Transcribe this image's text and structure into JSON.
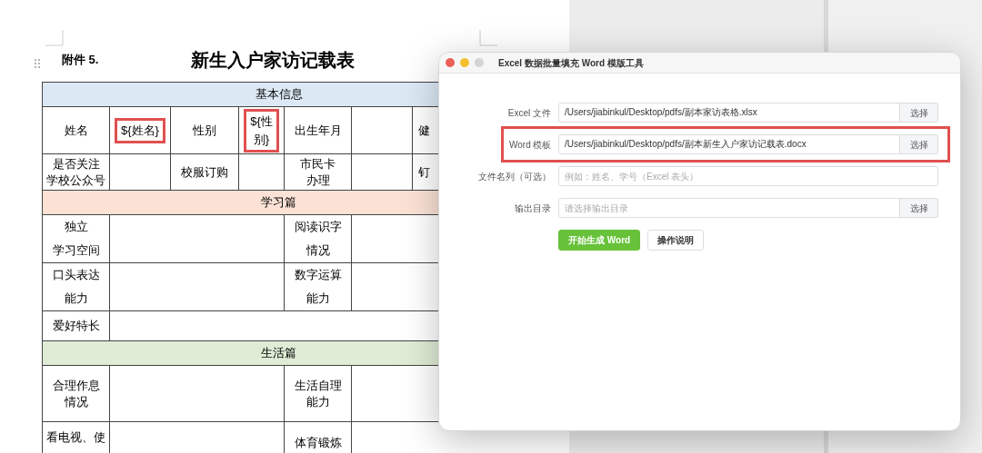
{
  "document": {
    "attachment_label": "附件 5.",
    "title": "新生入户家访记载表",
    "sections": [
      {
        "heading": "基本信息",
        "color": "#dce9f5",
        "rows": [
          {
            "cells": [
              {
                "kind": "label",
                "lines": [
                  "姓名"
                ]
              },
              {
                "kind": "label",
                "lines": [
                  "${姓名}"
                ],
                "highlighted": true
              },
              {
                "kind": "label",
                "lines": [
                  "性别"
                ]
              },
              {
                "kind": "label",
                "lines": [
                  "${性",
                  "别}"
                ],
                "highlighted": true
              },
              {
                "kind": "label",
                "lines": [
                  "出生年月"
                ]
              },
              {
                "kind": "blank"
              },
              {
                "kind": "label",
                "lines": [
                  "健"
                ]
              }
            ]
          },
          {
            "cells": [
              {
                "kind": "label",
                "lines": [
                  "是否关注",
                  "学校公众号"
                ]
              },
              {
                "kind": "blank"
              },
              {
                "kind": "label",
                "lines": [
                  "校服订购"
                ]
              },
              {
                "kind": "blank"
              },
              {
                "kind": "label",
                "lines": [
                  "市民卡",
                  "办理"
                ]
              },
              {
                "kind": "blank"
              },
              {
                "kind": "label",
                "lines": [
                  "钉"
                ]
              }
            ]
          }
        ]
      },
      {
        "heading": "学习篇",
        "color": "#fbe2d5",
        "rows": [
          {
            "cells": [
              {
                "kind": "label",
                "lines": [
                  "独立",
                  "学习空间"
                ]
              },
              {
                "kind": "blank"
              },
              {
                "kind": "label",
                "lines": [
                  "阅读识字",
                  "情况"
                ]
              },
              {
                "kind": "blank"
              }
            ]
          },
          {
            "cells": [
              {
                "kind": "label",
                "lines": [
                  "口头表达",
                  "能力"
                ]
              },
              {
                "kind": "blank"
              },
              {
                "kind": "label",
                "lines": [
                  "数字运算",
                  "能力"
                ]
              },
              {
                "kind": "blank"
              }
            ]
          },
          {
            "cells": [
              {
                "kind": "label",
                "lines": [
                  "爱好特长"
                ]
              },
              {
                "kind": "blank"
              }
            ]
          }
        ]
      },
      {
        "heading": "生活篇",
        "color": "#dfedd6",
        "rows": [
          {
            "cells": [
              {
                "kind": "label",
                "lines": [
                  "合理作息",
                  "情况"
                ]
              },
              {
                "kind": "blank"
              },
              {
                "kind": "label",
                "lines": [
                  "生活自理",
                  "能力"
                ]
              },
              {
                "kind": "blank"
              }
            ]
          },
          {
            "cells": [
              {
                "kind": "label",
                "lines": [
                  "看电视、使"
                ]
              },
              {
                "kind": "blank"
              },
              {
                "kind": "label",
                "lines": [
                  "体育锻炼"
                ]
              },
              {
                "kind": "blank"
              }
            ]
          }
        ]
      }
    ]
  },
  "dialog": {
    "title": "Excel 数据批量填充 Word 模版工具",
    "fields": [
      {
        "label": "Excel 文件",
        "value": "/Users/jiabinkul/Desktop/pdfs/副本家访表格.xlsx",
        "button": "选择",
        "highlighted": false
      },
      {
        "label": "Word 模板",
        "value": "/Users/jiabinkul/Desktop/pdfs/副本新生入户家访记载表.docx",
        "button": "选择",
        "highlighted": true
      },
      {
        "label": "文件名列（可选）",
        "placeholder": "例如：姓名、学号（Excel 表头）",
        "highlighted": false
      },
      {
        "label": "输出目录",
        "placeholder": "请选择输出目录",
        "button": "选择",
        "highlighted": false
      }
    ],
    "actions": [
      {
        "label": "开始生成 Word",
        "kind": "primary"
      },
      {
        "label": "操作说明",
        "kind": "secondary"
      }
    ]
  }
}
